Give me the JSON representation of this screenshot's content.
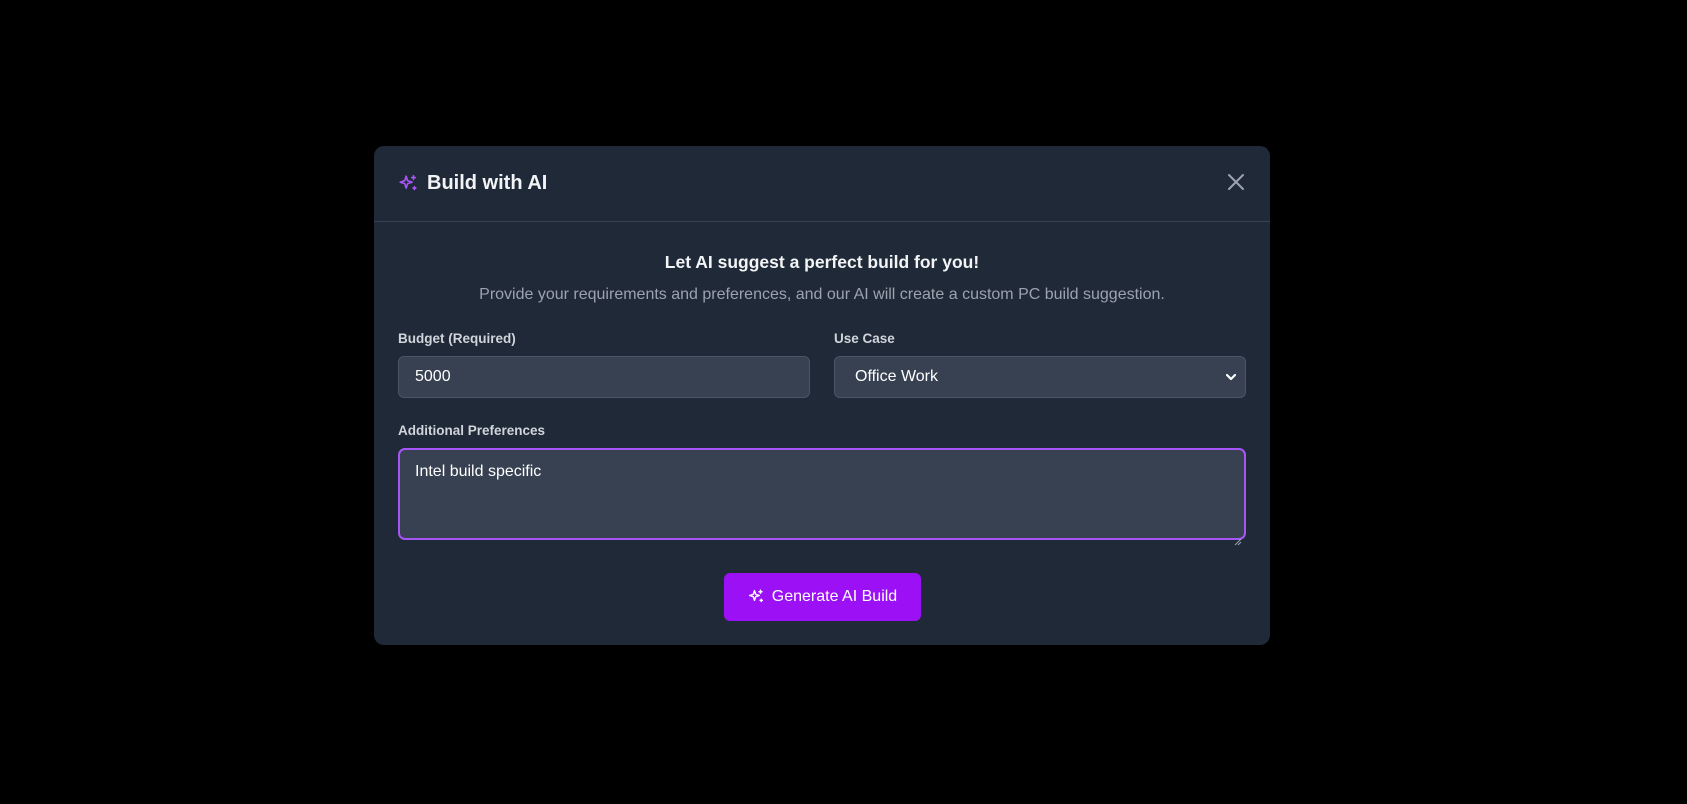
{
  "modal": {
    "title": "Build with AI",
    "title_icon": "sparkles-icon",
    "close_icon": "close-icon"
  },
  "intro": {
    "heading": "Let AI suggest a perfect build for you!",
    "description": "Provide your requirements and preferences, and our AI will create a custom PC build suggestion."
  },
  "budget": {
    "label": "Budget (Required)",
    "value": "5000"
  },
  "use_case": {
    "label": "Use Case",
    "selected": "Office Work"
  },
  "preferences": {
    "label": "Additional Preferences",
    "value": "Intel build specific"
  },
  "generate_button": {
    "label": "Generate AI Build",
    "icon": "sparkles-icon"
  },
  "colors": {
    "accent": "#a855f7",
    "button": "#9b10f5",
    "modal_bg": "#1f2937",
    "input_bg": "#374151"
  }
}
